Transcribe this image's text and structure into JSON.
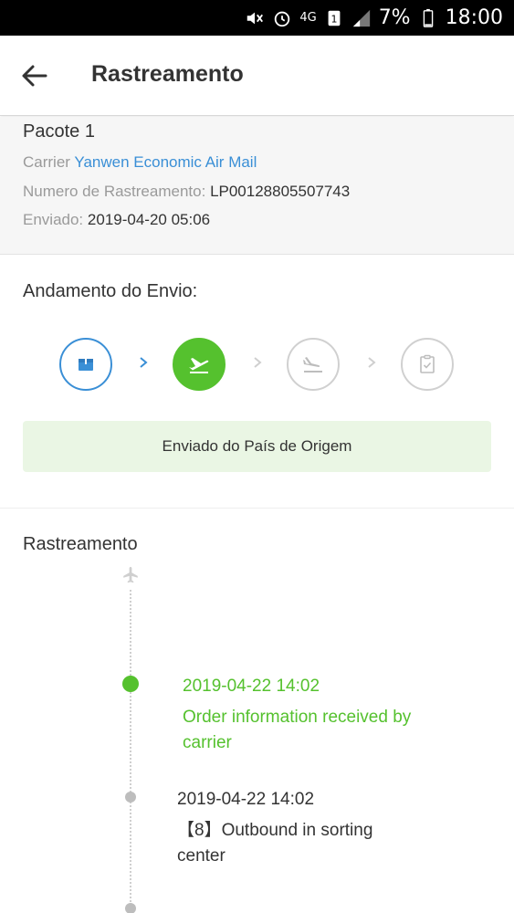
{
  "status_bar": {
    "battery": "7%",
    "time": "18:00",
    "network": "4G"
  },
  "header": {
    "title": "Rastreamento"
  },
  "package": {
    "title": "Pacote 1",
    "carrier_label": "Carrier",
    "carrier_value": "Yanwen Economic Air Mail",
    "tracking_label": "Numero de Rastreamento:",
    "tracking_value": "LP00128805507743",
    "shipped_label": "Enviado:",
    "shipped_value": "2019-04-20 05:06"
  },
  "progress": {
    "title": "Andamento do Envio:",
    "steps": [
      {
        "icon": "package-box-icon",
        "state": "done"
      },
      {
        "icon": "airplane-departure-icon",
        "state": "current"
      },
      {
        "icon": "airplane-arrival-icon",
        "state": "pending"
      },
      {
        "icon": "clipboard-check-icon",
        "state": "pending"
      }
    ],
    "status_text": "Enviado do País de Origem"
  },
  "tracking": {
    "title": "Rastreamento",
    "events": [
      {
        "time": "2019-04-22 14:02",
        "desc_line1": "Order information received by",
        "desc_line2": "carrier",
        "latest": true
      },
      {
        "time": "2019-04-22 14:02",
        "desc_line1": "【8】Outbound in sorting",
        "desc_line2": "center",
        "latest": false
      }
    ]
  },
  "colors": {
    "accent_blue": "#3a8fd6",
    "accent_green": "#55c12e",
    "banner_green": "#eaf6e4"
  }
}
